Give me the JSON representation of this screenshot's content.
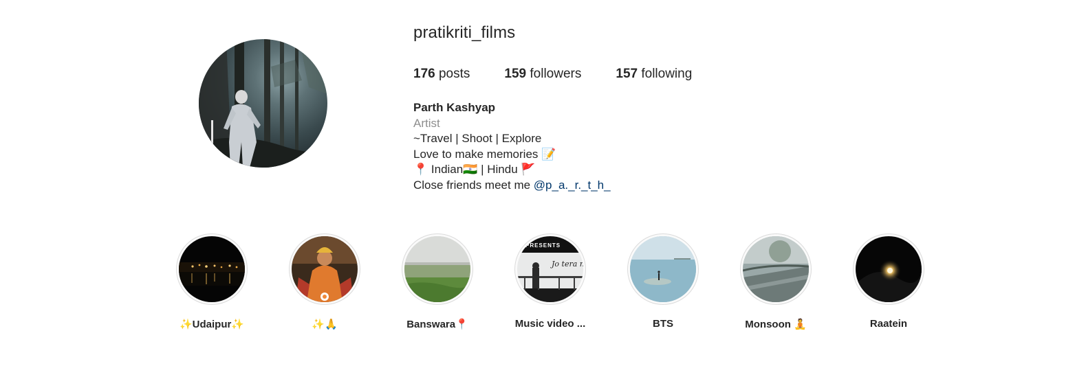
{
  "profile": {
    "username": "pratikriti_films",
    "stats": {
      "posts_count": "176",
      "posts_label": "posts",
      "followers_count": "159",
      "followers_label": "followers",
      "following_count": "157",
      "following_label": "following"
    },
    "bio": {
      "full_name": "Parth Kashyap",
      "category": "Artist",
      "line1": "~Travel | Shoot | Explore",
      "line2": "Love to make memories 📝",
      "line3": "📍 Indian🇮🇳 | Hindu 🚩",
      "line4_text": "Close friends meet me ",
      "line4_mention": "@p_a._r._t_h_"
    }
  },
  "highlights": [
    {
      "label": "✨Udaipur✨",
      "icon": "night-city-lake-thumbnail"
    },
    {
      "label": "✨🙏",
      "icon": "deity-thumbnail"
    },
    {
      "label": "Banswara📍",
      "icon": "landscape-thumbnail"
    },
    {
      "label": "Music video ...",
      "icon": "music-video-thumbnail",
      "overlay_top": "PRESENTS",
      "overlay_title": "Jo tera nahi"
    },
    {
      "label": "BTS",
      "icon": "lake-person-thumbnail"
    },
    {
      "label": "Monsoon 🧘",
      "icon": "rainy-road-thumbnail"
    },
    {
      "label": "Raatein",
      "icon": "moon-night-thumbnail"
    }
  ],
  "colors": {
    "text": "#262626",
    "secondary": "#8e8e8e",
    "link": "#00376b",
    "ring_border": "#dbdbdb"
  }
}
